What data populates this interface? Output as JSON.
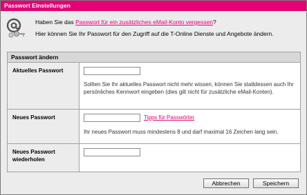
{
  "window": {
    "title": "Passwort Einstellungen"
  },
  "info": {
    "line1_prefix": "Haben Sie das ",
    "line1_link": "Passwort für ein zusätzliches eMail-Konto vergessen",
    "line1_suffix": "?",
    "line2": "Hier können Sie Ihr Passwort für den Zugriff auf die T-Online Dienste und Angebote ändern."
  },
  "panel": {
    "title": "Passwort ändern",
    "current": {
      "label": "Aktuelles Passwort",
      "value": "",
      "hint": "Sollten Sie Ihr aktuelles Passwort nicht mehr wissen, können Sie stattdessen auch Ihr persönliches Kennwort eingeben (dies gilt nicht für zusätzliche eMail-Konten)."
    },
    "new": {
      "label": "Neues Passwort",
      "value": "",
      "tips_link": "Tipps für Passwörter",
      "hint": "Ihr neues Passwort muss mindestens 8 und darf maximal 16 Zeichen lang sein."
    },
    "repeat": {
      "label": "Neues Passwort wiederholen",
      "value": ""
    }
  },
  "buttons": {
    "cancel": "Abbrechen",
    "save": "Speichern"
  },
  "colors": {
    "accent": "#e20074",
    "panel_header": "#d8d8d8"
  },
  "icons": {
    "info": "at-keys-icon"
  }
}
